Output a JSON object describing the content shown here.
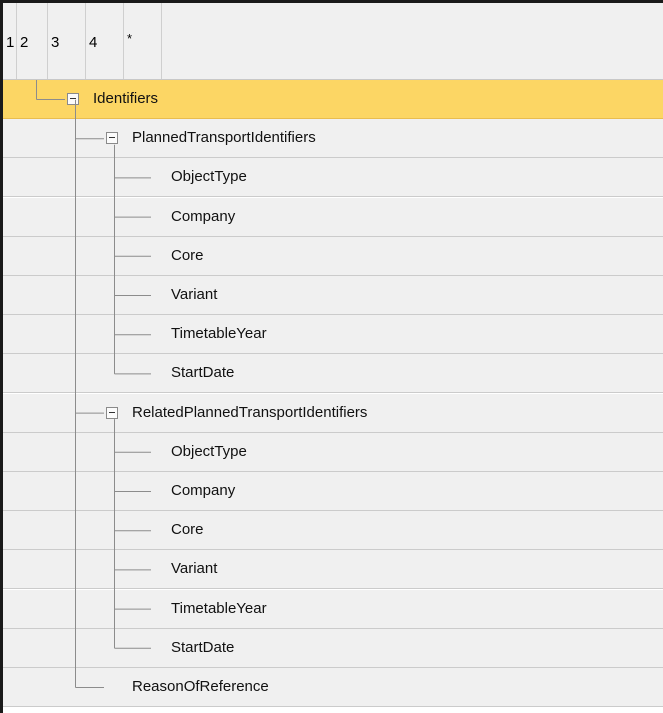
{
  "level_buttons": [
    "1",
    "2",
    "3",
    "4",
    "*"
  ],
  "rows": [
    {
      "label": "Identifiers",
      "level": 1,
      "toggle": true,
      "selected": true
    },
    {
      "label": "PlannedTransportIdentifiers",
      "level": 2,
      "toggle": true,
      "selected": false
    },
    {
      "label": "ObjectType",
      "level": 3,
      "toggle": false,
      "selected": false
    },
    {
      "label": "Company",
      "level": 3,
      "toggle": false,
      "selected": false
    },
    {
      "label": "Core",
      "level": 3,
      "toggle": false,
      "selected": false
    },
    {
      "label": "Variant",
      "level": 3,
      "toggle": false,
      "selected": false
    },
    {
      "label": "TimetableYear",
      "level": 3,
      "toggle": false,
      "selected": false
    },
    {
      "label": "StartDate",
      "level": 3,
      "toggle": false,
      "selected": false
    },
    {
      "label": "RelatedPlannedTransportIdentifiers",
      "level": 2,
      "toggle": true,
      "selected": false
    },
    {
      "label": "ObjectType",
      "level": 3,
      "toggle": false,
      "selected": false
    },
    {
      "label": "Company",
      "level": 3,
      "toggle": false,
      "selected": false
    },
    {
      "label": "Core",
      "level": 3,
      "toggle": false,
      "selected": false
    },
    {
      "label": "Variant",
      "level": 3,
      "toggle": false,
      "selected": false
    },
    {
      "label": "TimetableYear",
      "level": 3,
      "toggle": false,
      "selected": false
    },
    {
      "label": "StartDate",
      "level": 3,
      "toggle": false,
      "selected": false
    },
    {
      "label": "ReasonOfReference",
      "level": 2,
      "toggle": false,
      "selected": false
    }
  ],
  "colors": {
    "selected_row": "#fcd664",
    "row_background": "#f0f0f0",
    "tree_lines": "#8c8c8c"
  }
}
